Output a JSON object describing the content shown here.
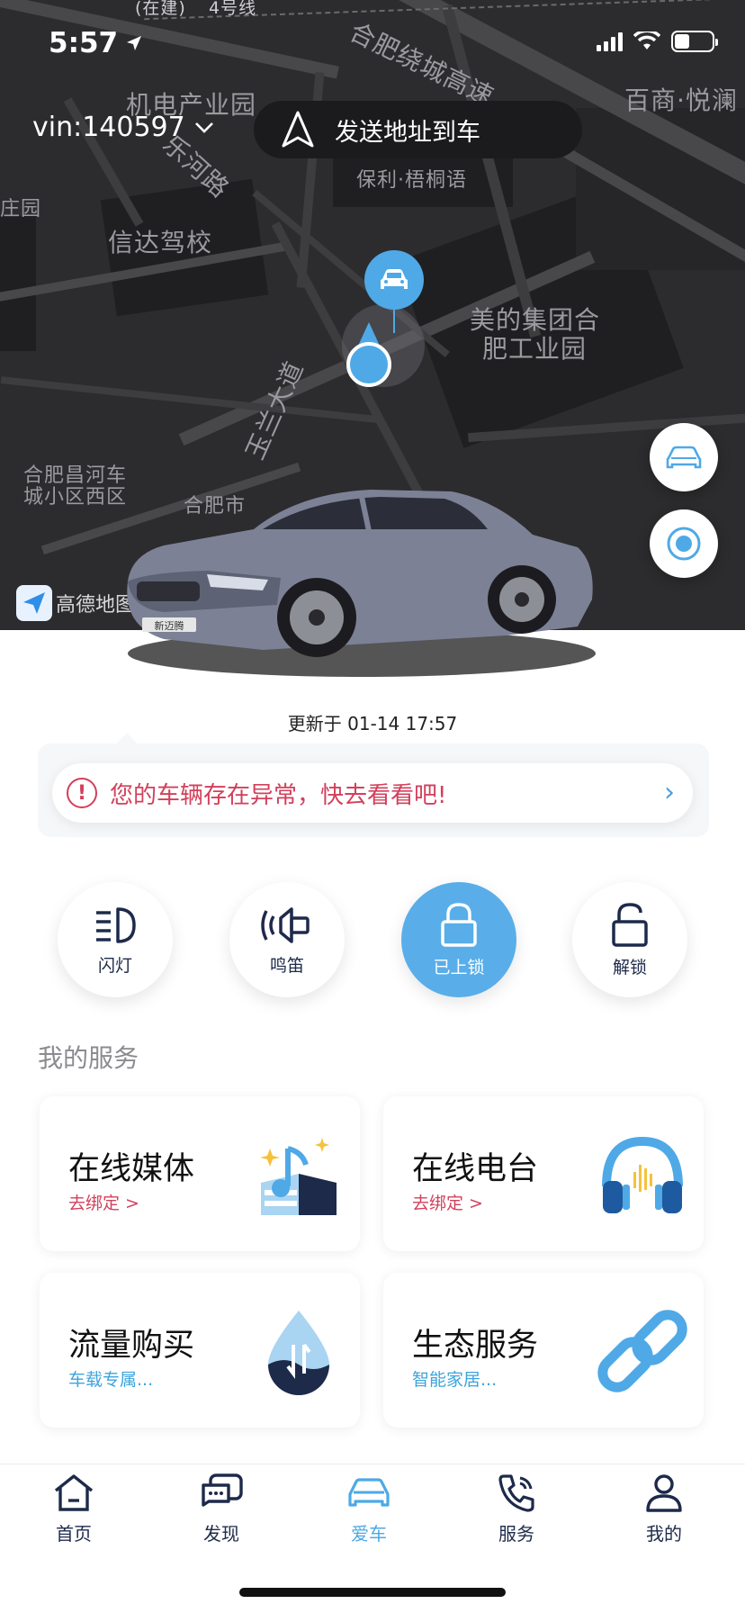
{
  "status_bar": {
    "time": "5:57"
  },
  "map": {
    "places": [
      "机电产业园",
      "合肥绕城高速",
      "百商·悦澜",
      "乐河路",
      "保利·梧桐语",
      "庄园",
      "信达驾校",
      "美的集团合",
      "肥工业园",
      "玉兰大道",
      "合肥昌河车",
      "城小区西区",
      "合肥市",
      "(在建)",
      "4号线"
    ],
    "logo_text": "高德地图"
  },
  "header": {
    "vin": "vin:140597",
    "send_address": "发送地址到车"
  },
  "vehicle": {
    "plate_badge": "新迈腾"
  },
  "updated": "更新于 01-14 17:57",
  "alert": {
    "text": "您的车辆存在异常，快去看看吧!"
  },
  "controls": [
    {
      "label": "闪灯",
      "icon": "headlight-icon"
    },
    {
      "label": "鸣笛",
      "icon": "horn-icon"
    },
    {
      "label": "已上锁",
      "icon": "lock-closed-icon",
      "active": true
    },
    {
      "label": "解锁",
      "icon": "lock-open-icon"
    }
  ],
  "services": {
    "title": "我的服务",
    "items": [
      {
        "title": "在线媒体",
        "sub": "去绑定 >",
        "icon": "music-box-icon"
      },
      {
        "title": "在线电台",
        "sub": "去绑定 >",
        "icon": "headphones-icon"
      },
      {
        "title": "流量购买",
        "sub": "车载专属...",
        "icon": "data-drop-icon"
      },
      {
        "title": "生态服务",
        "sub": "智能家居...",
        "icon": "chain-link-icon"
      }
    ]
  },
  "tabs": [
    {
      "label": "首页",
      "icon": "home-icon"
    },
    {
      "label": "发现",
      "icon": "chat-icon"
    },
    {
      "label": "爱车",
      "icon": "car-icon",
      "active": true
    },
    {
      "label": "服务",
      "icon": "phone-icon"
    },
    {
      "label": "我的",
      "icon": "user-icon"
    }
  ],
  "colors": {
    "accent": "#59aee9",
    "alert": "#d2405c",
    "link_blue": "#3da4dc",
    "nav_dark": "#1e2a4a"
  }
}
